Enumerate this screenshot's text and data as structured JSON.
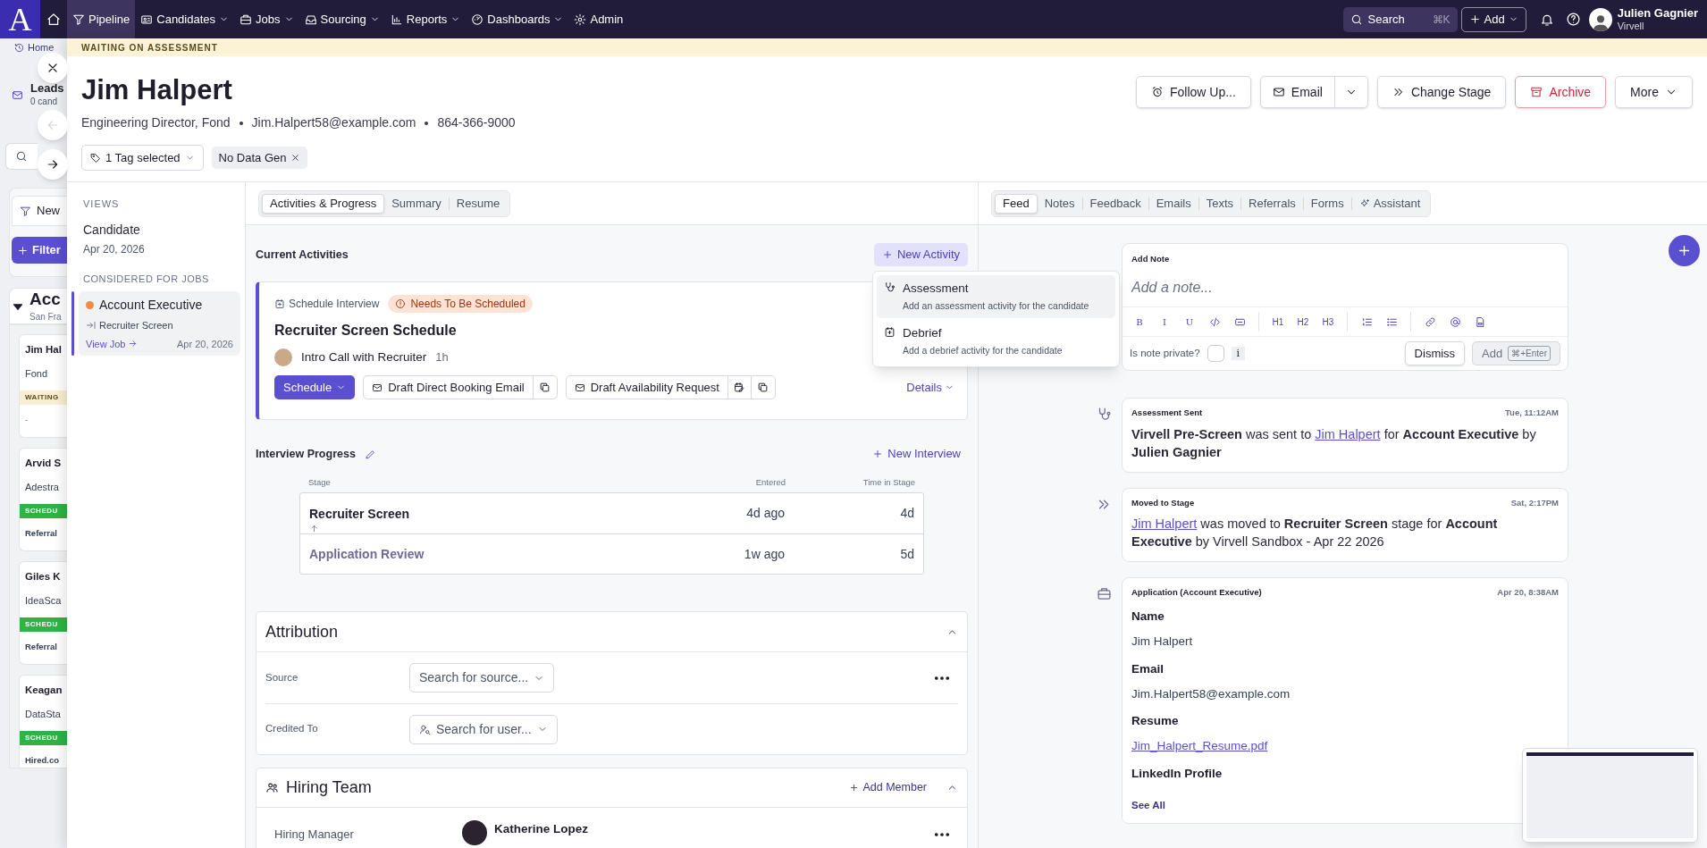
{
  "nav": {
    "logo": "A",
    "items": [
      {
        "label": "Pipeline",
        "has_menu": false,
        "selected": true
      },
      {
        "label": "Candidates",
        "has_menu": true,
        "selected": false
      },
      {
        "label": "Jobs",
        "has_menu": true,
        "selected": false
      },
      {
        "label": "Sourcing",
        "has_menu": true,
        "selected": false
      },
      {
        "label": "Reports",
        "has_menu": true,
        "selected": false
      },
      {
        "label": "Dashboards",
        "has_menu": true,
        "selected": false
      },
      {
        "label": "Admin",
        "has_menu": false,
        "selected": false
      }
    ],
    "search": {
      "label": "Search",
      "shortcut": "⌘K"
    },
    "add": "Add",
    "user": {
      "name": "Julien Gagnier",
      "org": "Virvell"
    }
  },
  "background_page": {
    "breadcrumb": "Home",
    "leads_title": "Leads",
    "leads_count": "0 cand",
    "tab": "New",
    "filter_button": "Filter",
    "job_title": "Acc",
    "job_location": "San Fra",
    "candidates": [
      {
        "name": "Jim Hal",
        "company": "Fond",
        "status": "WAITING",
        "kind": "waiting",
        "source": "-"
      },
      {
        "name": "Arvid S",
        "company": "Adestra",
        "status": "SCHEDU",
        "kind": "scheduled",
        "source": "Referral"
      },
      {
        "name": "Giles K",
        "company": "IdeaSca",
        "status": "SCHEDU",
        "kind": "scheduled",
        "source": "Referral"
      },
      {
        "name": "Keagan",
        "company": "DataSta",
        "status": "SCHEDU",
        "kind": "scheduled",
        "source": "Hired.co"
      }
    ]
  },
  "drawer": {
    "banner": "WAITING ON ASSESSMENT",
    "back_disabled": true,
    "candidate": {
      "name": "Jim Halpert",
      "details": [
        "Engineering Director, Fond",
        "Jim.Halpert58@example.com",
        "864-366-9000"
      ],
      "tag_select": "1 Tag selected",
      "tags": [
        "No Data Gen"
      ]
    },
    "actions": [
      {
        "label": "Follow Up...",
        "kind": "follow"
      },
      {
        "label": "Email",
        "kind": "split"
      },
      {
        "label": "Change Stage",
        "kind": "stage"
      },
      {
        "label": "Archive",
        "kind": "danger"
      },
      {
        "label": "More",
        "kind": "menu"
      }
    ],
    "views": {
      "heading": "VIEWS",
      "candidate_label": "Candidate",
      "candidate_date": "Apr 20, 2026",
      "jobs_heading": "CONSIDERED FOR JOBS",
      "jobs": [
        {
          "title": "Account Executive",
          "color": "#f28c45",
          "stage": "Recruiter Screen",
          "link": "View Job",
          "date": "Apr 20, 2026",
          "selected": true
        }
      ]
    },
    "tabs": [
      {
        "label": "Activities & Progress",
        "selected": true
      },
      {
        "label": "Summary",
        "selected": false
      },
      {
        "label": "Resume",
        "selected": false
      }
    ],
    "current_activities": {
      "title": "Current Activities",
      "new_button": "New Activity",
      "activity": {
        "type": "Schedule Interview",
        "badge": "Needs To Be Scheduled",
        "title": "Recruiter Screen Schedule",
        "interview": "Intro Call with Recruiter",
        "duration": "1h",
        "schedule_button": "Schedule",
        "draft_buttons": [
          "Draft Direct Booking Email",
          "Draft Availability Request"
        ],
        "details": "Details"
      }
    },
    "new_activity_menu": [
      {
        "title": "Assessment",
        "description": "Add an assessment activity for the candidate",
        "selected": true
      },
      {
        "title": "Debrief",
        "description": "Add a debrief activity for the candidate",
        "selected": false
      }
    ],
    "interview_progress": {
      "title": "Interview Progress",
      "new_button": "New Interview",
      "columns": [
        "Stage",
        "Entered",
        "Time in Stage"
      ],
      "rows": [
        {
          "stage": "Recruiter Screen",
          "entered": "4d ago",
          "time": "4d",
          "current": true
        },
        {
          "stage": "Application Review",
          "entered": "1w ago",
          "time": "5d",
          "current": false
        }
      ]
    },
    "attribution": {
      "title": "Attribution",
      "expanded": true,
      "fields": [
        {
          "label": "Source",
          "placeholder": "Search for source...",
          "kind": "source"
        },
        {
          "label": "Credited To",
          "placeholder": "Search for user...",
          "kind": "user"
        }
      ]
    },
    "hiring_team": {
      "title": "Hiring Team",
      "add_button": "Add Member",
      "expanded": true,
      "members": [
        {
          "role": "Hiring Manager",
          "name": "Katherine Lopez"
        }
      ]
    },
    "feed_tabs": [
      {
        "label": "Feed",
        "kind": "plain",
        "selected": true
      },
      {
        "label": "Notes",
        "kind": "plain",
        "selected": false
      },
      {
        "label": "Feedback",
        "kind": "plain",
        "selected": false
      },
      {
        "label": "Emails",
        "kind": "plain",
        "selected": false
      },
      {
        "label": "Texts",
        "kind": "plain",
        "selected": false
      },
      {
        "label": "Referrals",
        "kind": "plain",
        "selected": false
      },
      {
        "label": "Forms",
        "kind": "plain",
        "selected": false
      },
      {
        "label": "Assistant",
        "kind": "ai",
        "selected": false
      }
    ],
    "note": {
      "title": "Add Note",
      "placeholder": "Add a note...",
      "toolbar": [
        {
          "kind": "text",
          "label": "B"
        },
        {
          "kind": "text",
          "label": "I"
        },
        {
          "kind": "text",
          "label": "U"
        },
        {
          "kind": "code"
        },
        {
          "kind": "embed"
        },
        {
          "kind": "sep"
        },
        {
          "kind": "text",
          "label": "H1"
        },
        {
          "kind": "text",
          "label": "H2"
        },
        {
          "kind": "text",
          "label": "H3"
        },
        {
          "kind": "sep"
        },
        {
          "kind": "olist"
        },
        {
          "kind": "ulist"
        },
        {
          "kind": "sep"
        },
        {
          "kind": "link"
        },
        {
          "kind": "mention"
        },
        {
          "kind": "file"
        }
      ],
      "private_label": "Is note private?",
      "private": false,
      "info": "i",
      "dismiss": "Dismiss",
      "add": "Add",
      "add_shortcut": "⌘+Enter"
    },
    "feed": [
      {
        "kind": "assessment",
        "title": "Assessment Sent",
        "time": "Tue, 11:12AM",
        "parts": [
          {
            "kind": "text",
            "text": "**Virvell Pre-Screen** was sent to "
          },
          {
            "kind": "link",
            "text": "Jim Halpert"
          },
          {
            "kind": "text",
            "text": " for **Account Executive** by **Julien Gagnier**"
          }
        ]
      },
      {
        "kind": "stage",
        "title": "Moved to Stage",
        "time": "Sat, 2:17PM",
        "parts": [
          {
            "kind": "link",
            "text": "Jim Halpert"
          },
          {
            "kind": "text",
            "text": " was moved to **Recruiter Screen** stage for **Account Executive** by Virvell Sandbox - Apr 22 2026"
          }
        ]
      },
      {
        "kind": "application",
        "title": "Application (Account Executive)",
        "time": "Apr 20, 8:38AM",
        "fields": [
          {
            "label": "Name",
            "value": "Jim Halpert",
            "link": false
          },
          {
            "label": "Email",
            "value": "Jim.Halpert58@example.com",
            "link": false
          },
          {
            "label": "Resume",
            "value": "Jim_Halpert_Resume.pdf",
            "link": true
          },
          {
            "label": "LinkedIn Profile"
          }
        ],
        "see_all": "See All"
      }
    ]
  }
}
